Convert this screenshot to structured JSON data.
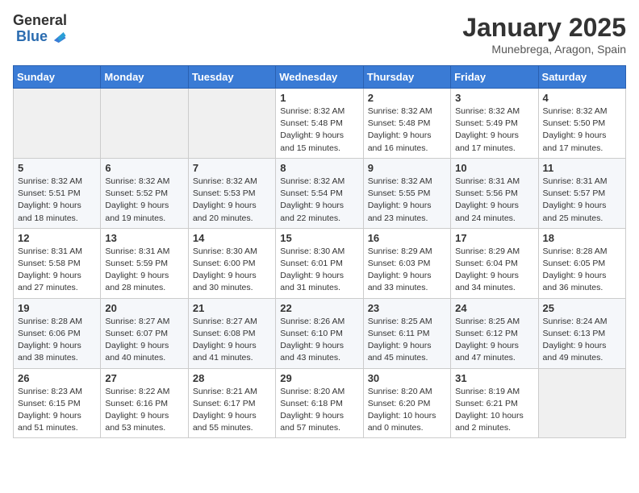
{
  "logo": {
    "text_general": "General",
    "text_blue": "Blue"
  },
  "title": "January 2025",
  "subtitle": "Munebrega, Aragon, Spain",
  "days_of_week": [
    "Sunday",
    "Monday",
    "Tuesday",
    "Wednesday",
    "Thursday",
    "Friday",
    "Saturday"
  ],
  "weeks": [
    [
      {
        "day": "",
        "info": ""
      },
      {
        "day": "",
        "info": ""
      },
      {
        "day": "",
        "info": ""
      },
      {
        "day": "1",
        "info": "Sunrise: 8:32 AM\nSunset: 5:48 PM\nDaylight: 9 hours\nand 15 minutes."
      },
      {
        "day": "2",
        "info": "Sunrise: 8:32 AM\nSunset: 5:48 PM\nDaylight: 9 hours\nand 16 minutes."
      },
      {
        "day": "3",
        "info": "Sunrise: 8:32 AM\nSunset: 5:49 PM\nDaylight: 9 hours\nand 17 minutes."
      },
      {
        "day": "4",
        "info": "Sunrise: 8:32 AM\nSunset: 5:50 PM\nDaylight: 9 hours\nand 17 minutes."
      }
    ],
    [
      {
        "day": "5",
        "info": "Sunrise: 8:32 AM\nSunset: 5:51 PM\nDaylight: 9 hours\nand 18 minutes."
      },
      {
        "day": "6",
        "info": "Sunrise: 8:32 AM\nSunset: 5:52 PM\nDaylight: 9 hours\nand 19 minutes."
      },
      {
        "day": "7",
        "info": "Sunrise: 8:32 AM\nSunset: 5:53 PM\nDaylight: 9 hours\nand 20 minutes."
      },
      {
        "day": "8",
        "info": "Sunrise: 8:32 AM\nSunset: 5:54 PM\nDaylight: 9 hours\nand 22 minutes."
      },
      {
        "day": "9",
        "info": "Sunrise: 8:32 AM\nSunset: 5:55 PM\nDaylight: 9 hours\nand 23 minutes."
      },
      {
        "day": "10",
        "info": "Sunrise: 8:31 AM\nSunset: 5:56 PM\nDaylight: 9 hours\nand 24 minutes."
      },
      {
        "day": "11",
        "info": "Sunrise: 8:31 AM\nSunset: 5:57 PM\nDaylight: 9 hours\nand 25 minutes."
      }
    ],
    [
      {
        "day": "12",
        "info": "Sunrise: 8:31 AM\nSunset: 5:58 PM\nDaylight: 9 hours\nand 27 minutes."
      },
      {
        "day": "13",
        "info": "Sunrise: 8:31 AM\nSunset: 5:59 PM\nDaylight: 9 hours\nand 28 minutes."
      },
      {
        "day": "14",
        "info": "Sunrise: 8:30 AM\nSunset: 6:00 PM\nDaylight: 9 hours\nand 30 minutes."
      },
      {
        "day": "15",
        "info": "Sunrise: 8:30 AM\nSunset: 6:01 PM\nDaylight: 9 hours\nand 31 minutes."
      },
      {
        "day": "16",
        "info": "Sunrise: 8:29 AM\nSunset: 6:03 PM\nDaylight: 9 hours\nand 33 minutes."
      },
      {
        "day": "17",
        "info": "Sunrise: 8:29 AM\nSunset: 6:04 PM\nDaylight: 9 hours\nand 34 minutes."
      },
      {
        "day": "18",
        "info": "Sunrise: 8:28 AM\nSunset: 6:05 PM\nDaylight: 9 hours\nand 36 minutes."
      }
    ],
    [
      {
        "day": "19",
        "info": "Sunrise: 8:28 AM\nSunset: 6:06 PM\nDaylight: 9 hours\nand 38 minutes."
      },
      {
        "day": "20",
        "info": "Sunrise: 8:27 AM\nSunset: 6:07 PM\nDaylight: 9 hours\nand 40 minutes."
      },
      {
        "day": "21",
        "info": "Sunrise: 8:27 AM\nSunset: 6:08 PM\nDaylight: 9 hours\nand 41 minutes."
      },
      {
        "day": "22",
        "info": "Sunrise: 8:26 AM\nSunset: 6:10 PM\nDaylight: 9 hours\nand 43 minutes."
      },
      {
        "day": "23",
        "info": "Sunrise: 8:25 AM\nSunset: 6:11 PM\nDaylight: 9 hours\nand 45 minutes."
      },
      {
        "day": "24",
        "info": "Sunrise: 8:25 AM\nSunset: 6:12 PM\nDaylight: 9 hours\nand 47 minutes."
      },
      {
        "day": "25",
        "info": "Sunrise: 8:24 AM\nSunset: 6:13 PM\nDaylight: 9 hours\nand 49 minutes."
      }
    ],
    [
      {
        "day": "26",
        "info": "Sunrise: 8:23 AM\nSunset: 6:15 PM\nDaylight: 9 hours\nand 51 minutes."
      },
      {
        "day": "27",
        "info": "Sunrise: 8:22 AM\nSunset: 6:16 PM\nDaylight: 9 hours\nand 53 minutes."
      },
      {
        "day": "28",
        "info": "Sunrise: 8:21 AM\nSunset: 6:17 PM\nDaylight: 9 hours\nand 55 minutes."
      },
      {
        "day": "29",
        "info": "Sunrise: 8:20 AM\nSunset: 6:18 PM\nDaylight: 9 hours\nand 57 minutes."
      },
      {
        "day": "30",
        "info": "Sunrise: 8:20 AM\nSunset: 6:20 PM\nDaylight: 10 hours\nand 0 minutes."
      },
      {
        "day": "31",
        "info": "Sunrise: 8:19 AM\nSunset: 6:21 PM\nDaylight: 10 hours\nand 2 minutes."
      },
      {
        "day": "",
        "info": ""
      }
    ]
  ]
}
